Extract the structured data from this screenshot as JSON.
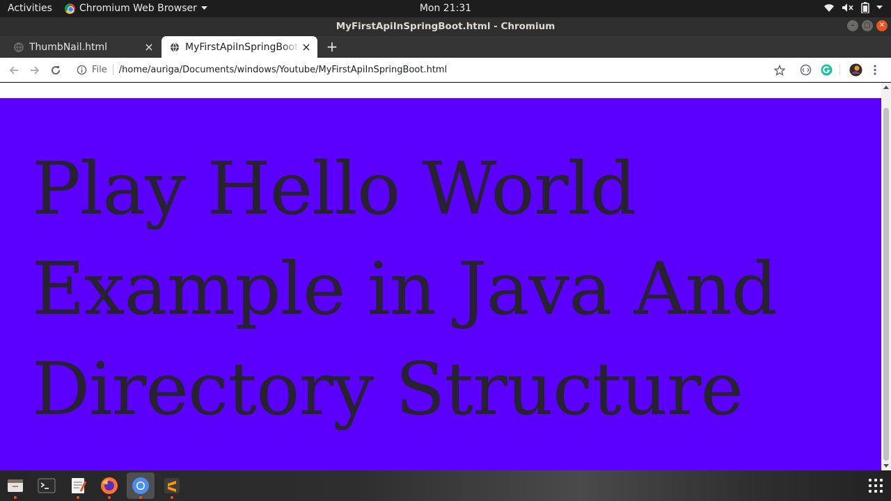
{
  "topbar": {
    "activities": "Activities",
    "app_menu": "Chromium Web Browser",
    "clock": "Mon 21:31"
  },
  "window": {
    "title": "MyFirstApiInSpringBoot.html - Chromium"
  },
  "tabs": [
    {
      "label": "ThumbNail.html",
      "active": false
    },
    {
      "label": "MyFirstApiInSpringBoot.html",
      "active": true
    }
  ],
  "toolbar": {
    "scheme_label": "File",
    "url": "/home/auriga/Documents/windows/Youtube/MyFirstApiInSpringBoot.html"
  },
  "page": {
    "heading": "Play Hello World Example in Java And Directory Structure",
    "background_color": "#5b00ff",
    "text_color": "#26232f"
  },
  "dock": {
    "apps": [
      "file-manager-icon",
      "terminal-icon",
      "text-editor-icon",
      "firefox-icon",
      "chromium-icon",
      "sublime-text-icon"
    ]
  },
  "colors": {
    "accent": "#e95420",
    "tab_strip": "#353535"
  }
}
